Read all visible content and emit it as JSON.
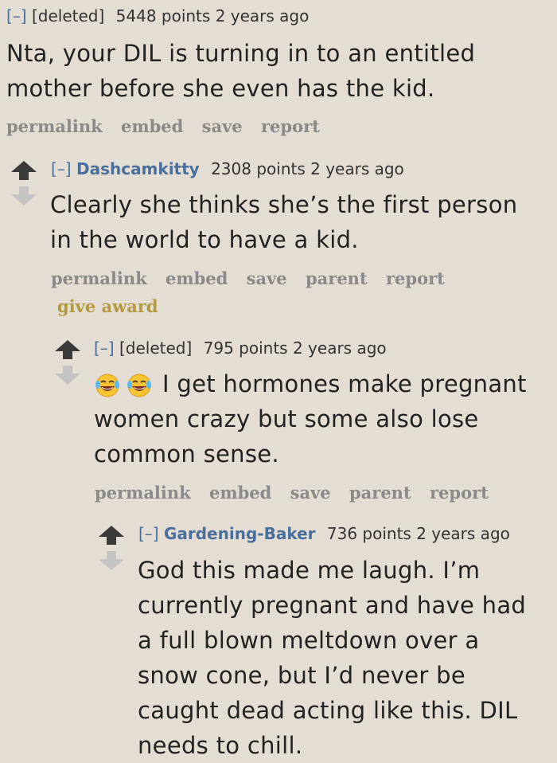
{
  "comments": [
    {
      "toggle": "[–]",
      "author": "[deleted]",
      "score": "5448 points",
      "age": "2 years ago",
      "body_lines": [
        "Nta, your DIL is turning in to an entitled",
        "mother before she even has the kid."
      ],
      "actions": [
        "permalink",
        "embed",
        "save",
        "report"
      ]
    },
    {
      "toggle": "[–]",
      "author": "Dashcamkitty",
      "score": "2308 points",
      "age": "2 years ago",
      "body_lines": [
        "Clearly she thinks she’s the first person",
        "in the world to have a kid."
      ],
      "actions": [
        "permalink",
        "embed",
        "save",
        "parent",
        "report"
      ],
      "award": "give award"
    },
    {
      "toggle": "[–]",
      "author": "[deleted]",
      "score": "795 points",
      "age": "2 years ago",
      "body_lines": [
        "I get hormones make pregnant",
        "women crazy but some also lose",
        "common sense."
      ],
      "emojis": [
        "laughing-tears-emoji",
        "laughing-tears-emoji"
      ],
      "actions": [
        "permalink",
        "embed",
        "save",
        "parent",
        "report"
      ]
    },
    {
      "toggle": "[–]",
      "author": "Gardening-Baker",
      "score": "736 points",
      "age": "2 years ago",
      "body_lines": [
        "God this made me laugh. I’m",
        "currently pregnant and have had",
        "a full blown meltdown over a",
        "snow cone, but I’d never be",
        "caught dead acting like this. DIL",
        "needs to chill."
      ]
    }
  ],
  "colors": {
    "background": "#e3ddd3",
    "link_blue": "#4a6f9c",
    "action_gray": "#8a8a8a",
    "award_gold": "#b49a3c",
    "upvote_dark": "#3a3a3a",
    "downvote_light": "#c4c4c4"
  },
  "icons": [
    "upvote-arrow-icon",
    "downvote-arrow-icon",
    "laughing-tears-emoji"
  ]
}
